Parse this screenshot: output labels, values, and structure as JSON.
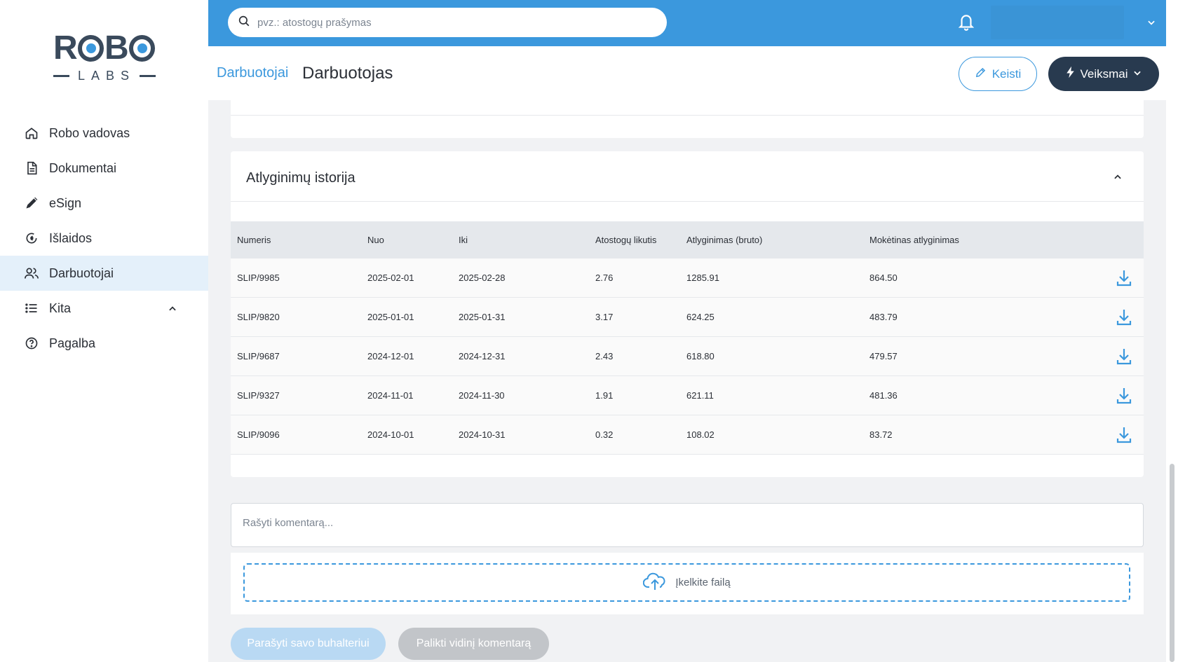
{
  "app": {
    "logo_top": "ROBO",
    "logo_bottom": "LABS"
  },
  "sidebar": {
    "items": [
      {
        "label": "Robo vadovas",
        "icon": "home-icon"
      },
      {
        "label": "Dokumentai",
        "icon": "document-icon"
      },
      {
        "label": "eSign",
        "icon": "pen-icon"
      },
      {
        "label": "Išlaidos",
        "icon": "expenses-icon"
      },
      {
        "label": "Darbuotojai",
        "icon": "users-icon",
        "active": true
      },
      {
        "label": "Kita",
        "icon": "list-icon"
      },
      {
        "label": "Pagalba",
        "icon": "help-icon"
      }
    ]
  },
  "topbar": {
    "search_placeholder": "pvz.: atostogų prašymas",
    "search_value": ""
  },
  "header": {
    "breadcrumb": "Darbuotojai",
    "title": "Darbuotojas",
    "edit_label": "Keisti",
    "actions_label": "Veiksmai"
  },
  "salary_history": {
    "title": "Atlyginimų istorija",
    "columns": [
      "Numeris",
      "Nuo",
      "Iki",
      "Atostogų likutis",
      "Atlyginimas (bruto)",
      "Mokėtinas atlyginimas"
    ],
    "rows": [
      [
        "SLIP/9985",
        "2025-02-01",
        "2025-02-28",
        "2.76",
        "1285.91",
        "864.50"
      ],
      [
        "SLIP/9820",
        "2025-01-01",
        "2025-01-31",
        "3.17",
        "624.25",
        "483.79"
      ],
      [
        "SLIP/9687",
        "2024-12-01",
        "2024-12-31",
        "2.43",
        "618.80",
        "479.57"
      ],
      [
        "SLIP/9327",
        "2024-11-01",
        "2024-11-30",
        "1.91",
        "621.11",
        "481.36"
      ],
      [
        "SLIP/9096",
        "2024-10-01",
        "2024-10-31",
        "0.32",
        "108.02",
        "83.72"
      ]
    ]
  },
  "comment": {
    "placeholder": "Rašyti komentarą..."
  },
  "upload": {
    "label": "Įkelkite failą"
  },
  "buttons": {
    "write_accountant": "Parašyti savo buhalteriui",
    "internal_comment": "Palikti vidinį komentarą"
  },
  "colors": {
    "primary": "#3b98dd",
    "dark": "#283a4f",
    "active_bg": "#e4f0fa"
  }
}
